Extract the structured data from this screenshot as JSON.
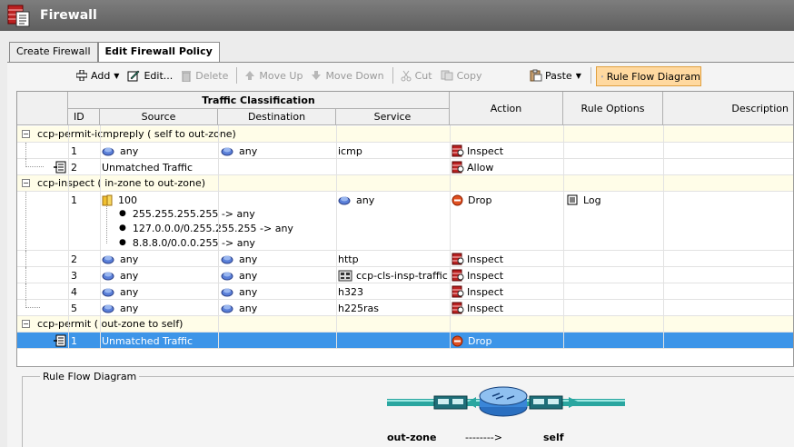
{
  "window": {
    "title": "Firewall"
  },
  "tabs": [
    "Create Firewall",
    "Edit Firewall Policy"
  ],
  "toolbar": {
    "add": "Add",
    "edit": "Edit...",
    "delete": "Delete",
    "move_up": "Move Up",
    "move_down": "Move Down",
    "cut": "Cut",
    "copy": "Copy",
    "paste": "Paste",
    "rule_flow": "Rule Flow Diagram"
  },
  "headers": {
    "traffic_classification": "Traffic Classification",
    "id": "ID",
    "source": "Source",
    "destination": "Destination",
    "service": "Service",
    "action": "Action",
    "rule_options": "Rule Options",
    "description": "Description"
  },
  "groups": {
    "g1": "ccp-permit-icmpreply ( self  to  out-zone)",
    "g2": "ccp-inspect ( in-zone  to  out-zone)",
    "g3": "ccp-permit ( out-zone  to  self)"
  },
  "rows": {
    "r1": {
      "id": "1",
      "source": "any",
      "destination": "any",
      "service": "icmp",
      "action": "Inspect"
    },
    "r2": {
      "id": "2",
      "source": "Unmatched Traffic",
      "action": "Allow"
    },
    "r3": {
      "id": "1",
      "source": "100",
      "destination": "any",
      "action": "Drop",
      "options": "Log",
      "acl": [
        "255.255.255.255 -> any",
        "127.0.0.0/0.255.255.255 -> any",
        "8.8.8.0/0.0.0.255 -> any"
      ]
    },
    "r4": {
      "id": "2",
      "source": "any",
      "destination": "any",
      "service": "http",
      "action": "Inspect"
    },
    "r5": {
      "id": "3",
      "source": "any",
      "destination": "any",
      "service": "ccp-cls-insp-traffic",
      "action": "Inspect"
    },
    "r6": {
      "id": "4",
      "source": "any",
      "destination": "any",
      "service": "h323",
      "action": "Inspect"
    },
    "r7": {
      "id": "5",
      "source": "any",
      "destination": "any",
      "service": "h225ras",
      "action": "Inspect"
    },
    "r8": {
      "id": "1",
      "source": "Unmatched Traffic",
      "action": "Drop"
    }
  },
  "rule_flow": {
    "title": "Rule Flow Diagram",
    "from_zone": "out-zone",
    "arrow": "-------->",
    "to_zone": "self"
  }
}
